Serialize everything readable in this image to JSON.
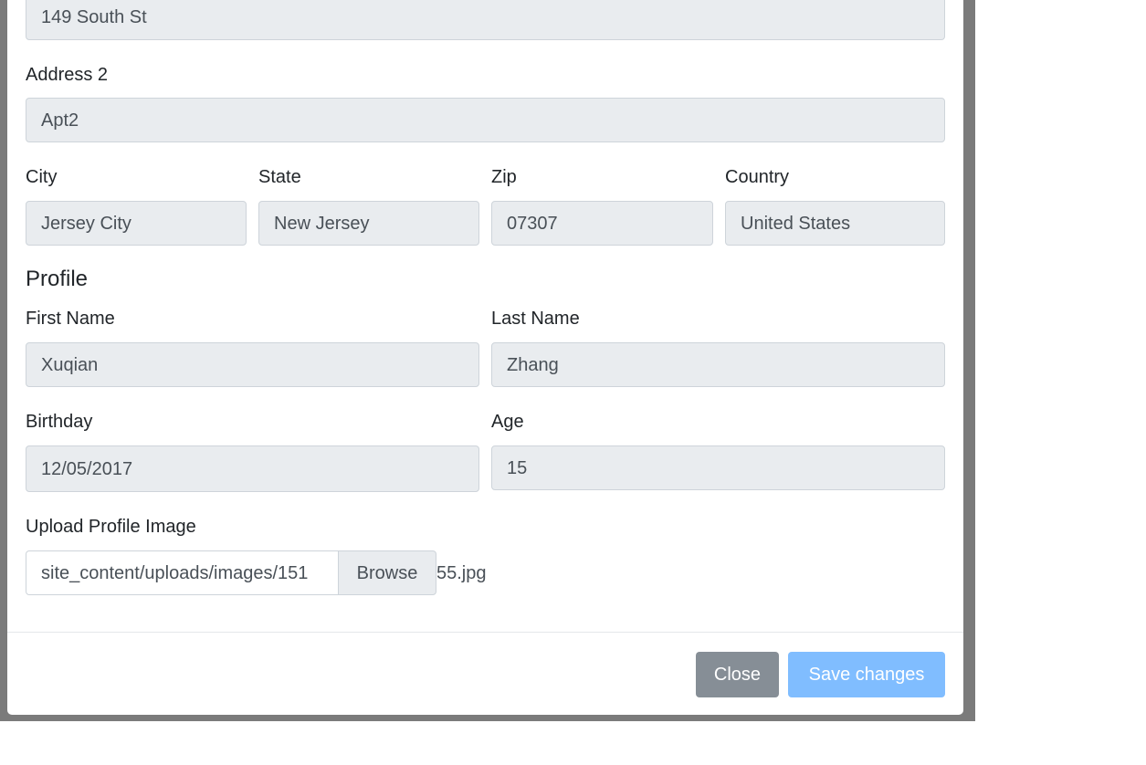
{
  "address": {
    "address1_value": "149 South St",
    "address2_label": "Address 2",
    "address2_value": "Apt2",
    "city_label": "City",
    "city_value": "Jersey City",
    "state_label": "State",
    "state_value": "New Jersey",
    "zip_label": "Zip",
    "zip_value": "07307",
    "country_label": "Country",
    "country_value": "United States"
  },
  "profile": {
    "heading": "Profile",
    "first_name_label": "First Name",
    "first_name_value": "Xuqian",
    "last_name_label": "Last Name",
    "last_name_value": "Zhang",
    "birthday_label": "Birthday",
    "birthday_value": "12/05/2017",
    "age_label": "Age",
    "age_value": "15",
    "upload_label": "Upload Profile Image",
    "upload_value": "site_content/uploads/images/151",
    "upload_value_tail": "55.jpg",
    "browse_label": "Browse"
  },
  "footer": {
    "close_label": "Close",
    "save_label": "Save changes"
  },
  "colors": {
    "backdrop": "#7b7b7b",
    "field_bg": "#e9ecef",
    "close_button": "#868e96",
    "save_button": "#80bdff"
  }
}
